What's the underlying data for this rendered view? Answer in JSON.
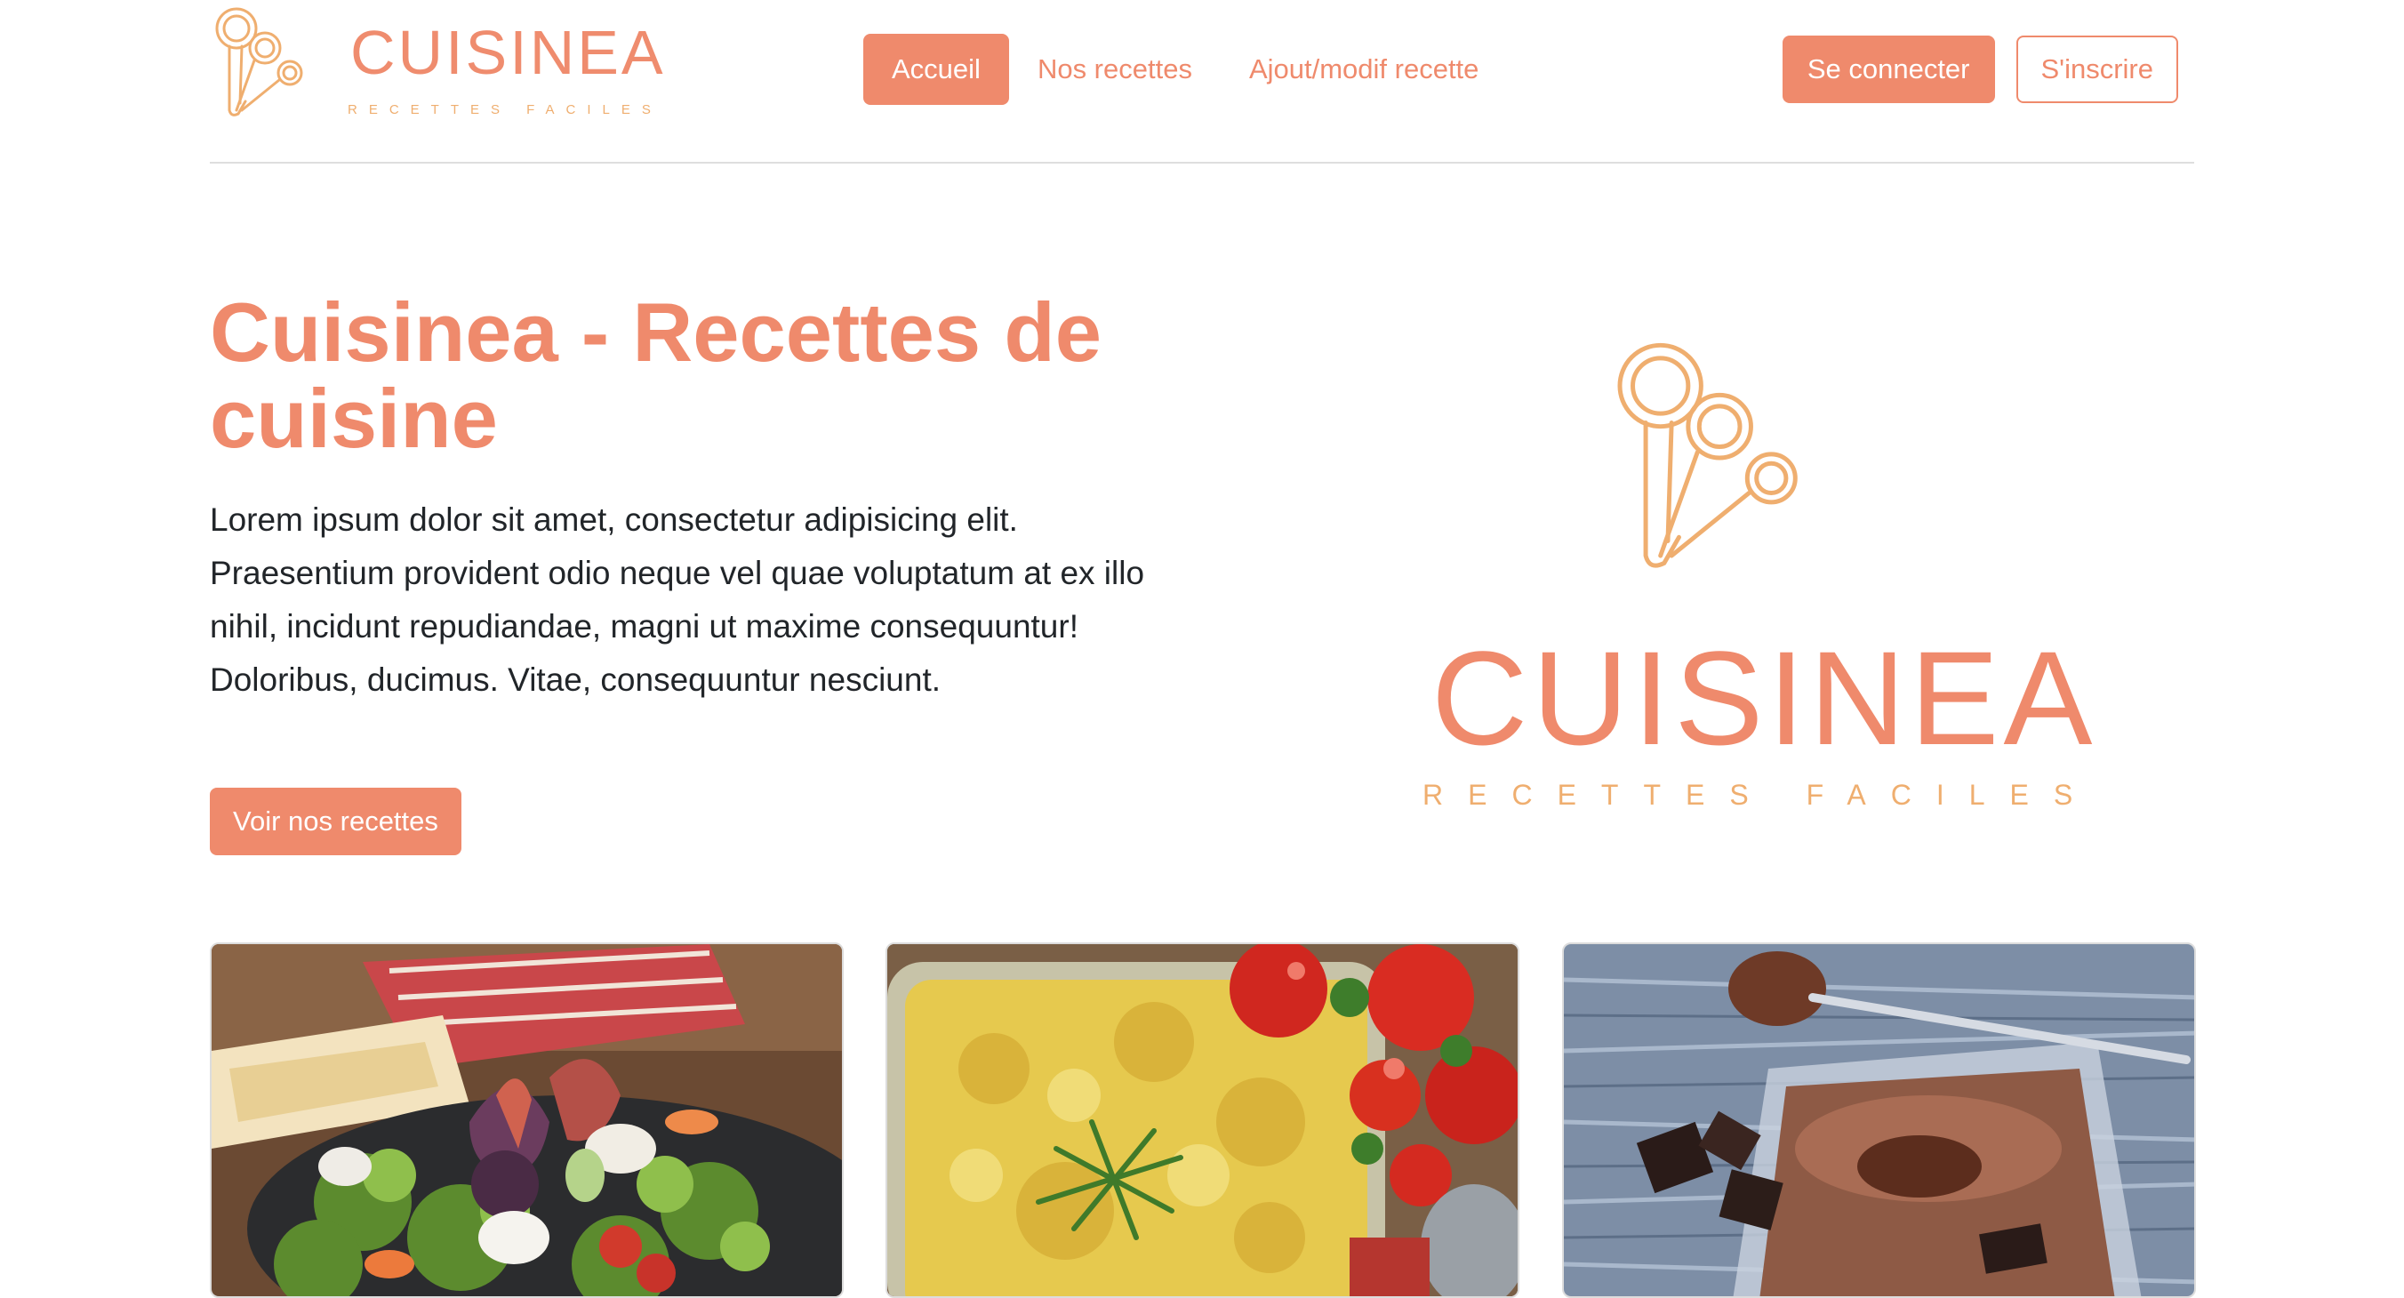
{
  "brand": {
    "name": "CUISINEA",
    "tagline": "RECETTES FACILES",
    "primary_color": "#ef8a6c",
    "secondary_color": "#efae6f"
  },
  "nav": {
    "items": [
      {
        "label": "Accueil",
        "active": true
      },
      {
        "label": "Nos recettes",
        "active": false
      },
      {
        "label": "Ajout/modif recette",
        "active": false
      }
    ]
  },
  "auth": {
    "login_label": "Se connecter",
    "signup_label": "S'inscrire"
  },
  "hero": {
    "title": "Cuisinea - Recettes de cuisine",
    "text": "Lorem ipsum dolor sit amet, consectetur adipisicing elit. Praesentium provident odio neque vel quae voluptatum at ex illo nihil, incidunt repudiandae, magni ut maxime consequuntur! Doloribus, ducimus. Vitae, consequuntur nesciunt.",
    "cta_label": "Voir nos recettes",
    "logo_name": "CUISINEA",
    "logo_tagline": "RECETTES FACILES"
  },
  "recipes": [
    {
      "image": "salad-with-figs-and-goat-cheese"
    },
    {
      "image": "gratin-with-tomatoes"
    },
    {
      "image": "chocolate-mousse"
    }
  ]
}
